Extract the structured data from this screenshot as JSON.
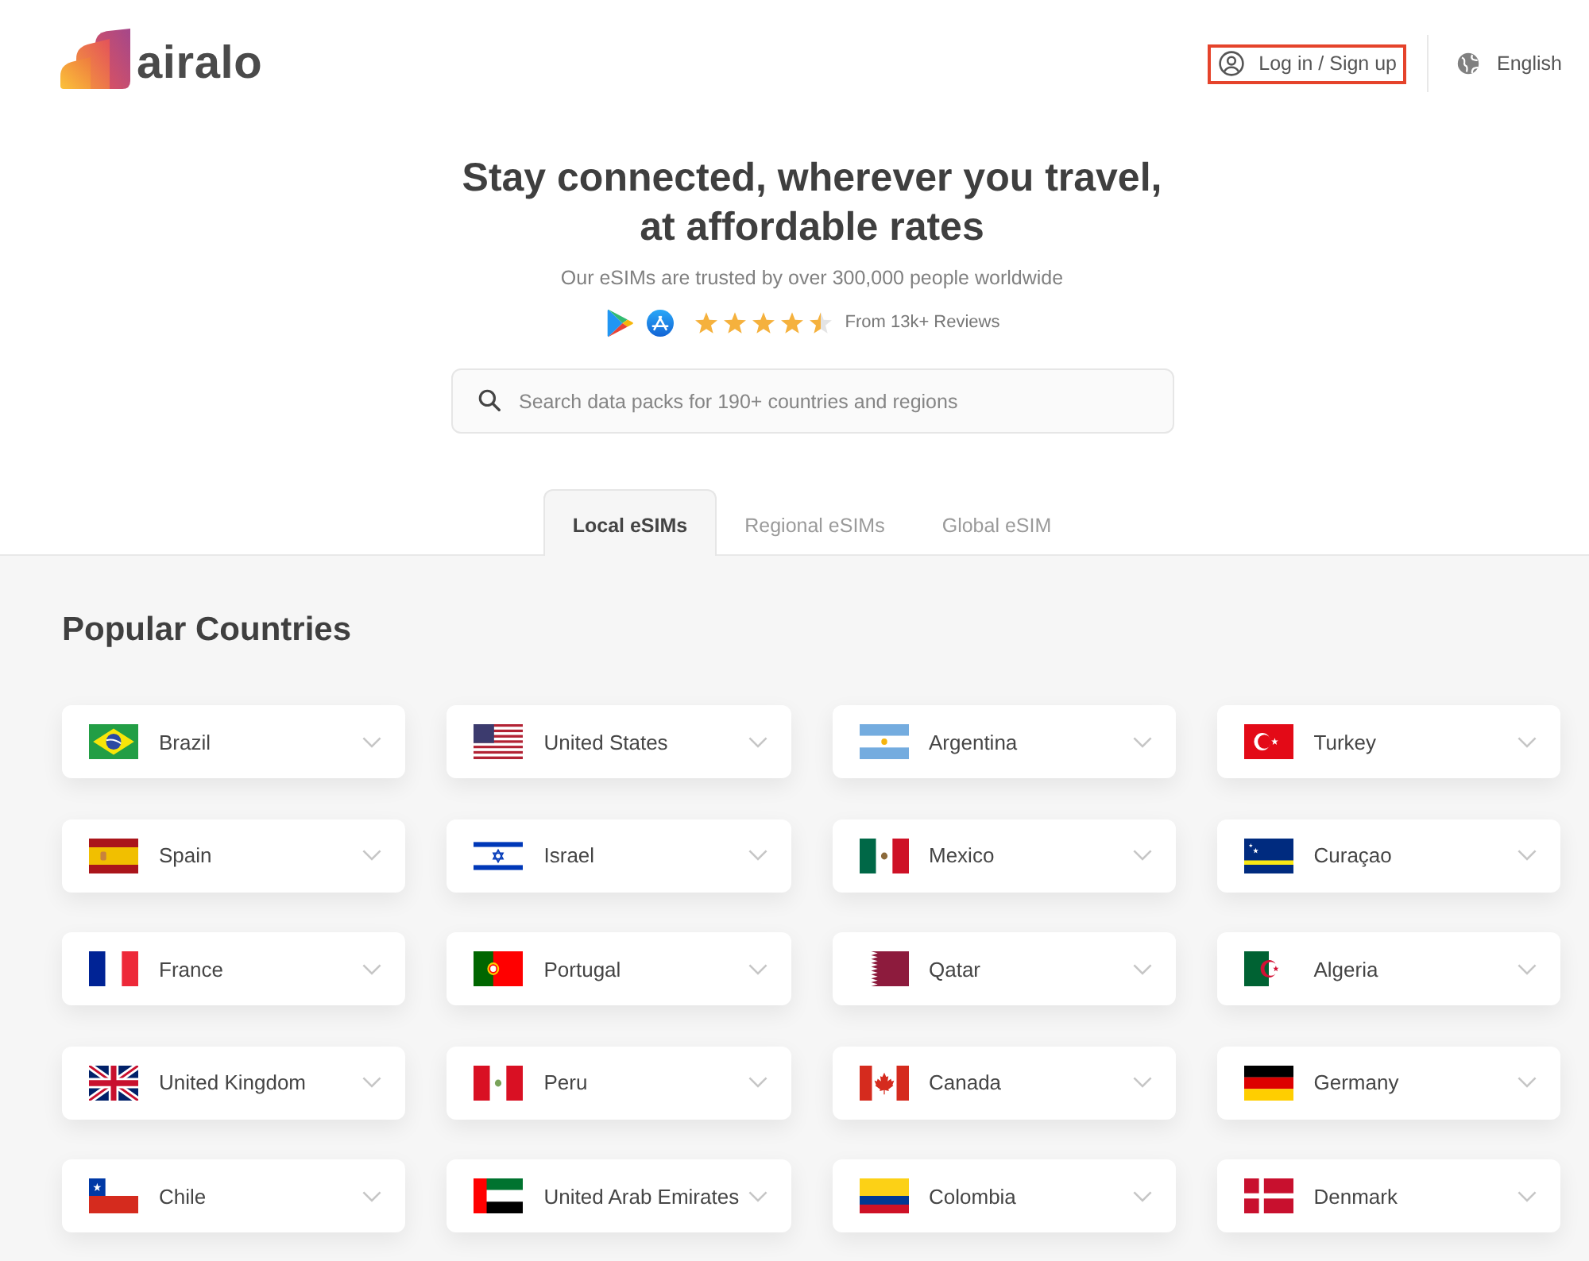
{
  "header": {
    "logo": "airalo",
    "login": {
      "label": "Log in / Sign up",
      "highlighted": true
    },
    "language": {
      "label": "English"
    }
  },
  "hero": {
    "title": "Stay connected, wherever you travel,\nat affordable rates",
    "subtitle": "Our eSIMs are trusted by over 300,000 people worldwide",
    "rating": {
      "stars": 4.5,
      "reviews": "From 13k+ Reviews"
    },
    "search": {
      "placeholder": "Search data packs for 190+ countries and regions"
    }
  },
  "tabs": [
    {
      "label": "Local eSIMs",
      "selected": true
    },
    {
      "label": "Regional eSIMs",
      "selected": false
    },
    {
      "label": "Global eSIM",
      "selected": false
    }
  ],
  "popular": {
    "title": "Popular Countries",
    "countries": [
      {
        "name": "Brazil",
        "kind": "br"
      },
      {
        "name": "United States",
        "kind": "us"
      },
      {
        "name": "Argentina",
        "kind": "ar"
      },
      {
        "name": "Turkey",
        "kind": "tr"
      },
      {
        "name": "Spain",
        "kind": "es"
      },
      {
        "name": "Israel",
        "kind": "il"
      },
      {
        "name": "Mexico",
        "kind": "mx"
      },
      {
        "name": "Curaçao",
        "kind": "cw"
      },
      {
        "name": "France",
        "kind": "fr"
      },
      {
        "name": "Portugal",
        "kind": "pt"
      },
      {
        "name": "Qatar",
        "kind": "qa"
      },
      {
        "name": "Algeria",
        "kind": "dz"
      },
      {
        "name": "United Kingdom",
        "kind": "gb"
      },
      {
        "name": "Peru",
        "kind": "pe"
      },
      {
        "name": "Canada",
        "kind": "ca"
      },
      {
        "name": "Germany",
        "kind": "de"
      },
      {
        "name": "Chile",
        "kind": "cl"
      },
      {
        "name": "United Arab Emirates",
        "kind": "ae"
      },
      {
        "name": "Colombia",
        "kind": "co"
      },
      {
        "name": "Denmark",
        "kind": "dk"
      }
    ]
  }
}
